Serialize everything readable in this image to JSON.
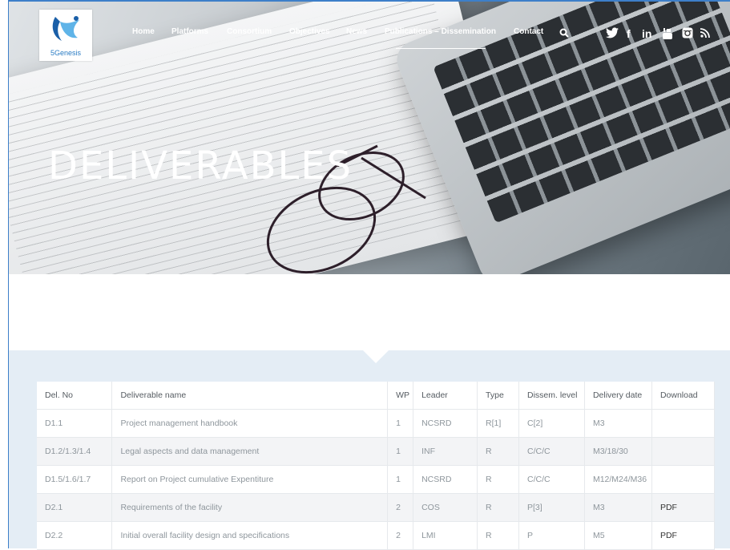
{
  "brand": {
    "name": "5Genesis"
  },
  "nav": {
    "items": [
      {
        "label": "Home"
      },
      {
        "label": "Platforms"
      },
      {
        "label": "Consortium"
      },
      {
        "label": "Objectives"
      },
      {
        "label": "News"
      },
      {
        "label": "Publications – Dissemination"
      },
      {
        "label": "Contact"
      }
    ],
    "active": "Publications – Dissemination"
  },
  "social": [
    "search-icon",
    "twitter-icon",
    "facebook-icon",
    "linkedin-icon",
    "youtube-icon",
    "instagram-icon",
    "rss-icon"
  ],
  "hero": {
    "title": "DELIVERABLES"
  },
  "table": {
    "headers": [
      "Del. No",
      "Deliverable name",
      "WP",
      "Leader",
      "Type",
      "Dissem. level",
      "Delivery date",
      "Download"
    ],
    "rows": [
      [
        "D1.1",
        "Project management handbook",
        "1",
        "NCSRD",
        "R[1]",
        "C[2]",
        "M3",
        ""
      ],
      [
        "D1.2/1.3/1.4",
        "Legal aspects and data management",
        "1",
        "INF",
        "R",
        "C/C/C",
        "M3/18/30",
        ""
      ],
      [
        "D1.5/1.6/1.7",
        "Report on Project cumulative Expentiture",
        "1",
        "NCSRD",
        "R",
        "C/C/C",
        "M12/M24/M36",
        ""
      ],
      [
        "D2.1",
        "Requirements of the facility",
        "2",
        "COS",
        "R",
        "P[3]",
        "M3",
        "PDF"
      ],
      [
        "D2.2",
        "Initial overall facility design and specifications",
        "2",
        "LMI",
        "R",
        "P",
        "M5",
        "PDF"
      ]
    ]
  },
  "colors": {
    "accent": "#2a7cc4",
    "content_bg": "#e4edf5"
  }
}
